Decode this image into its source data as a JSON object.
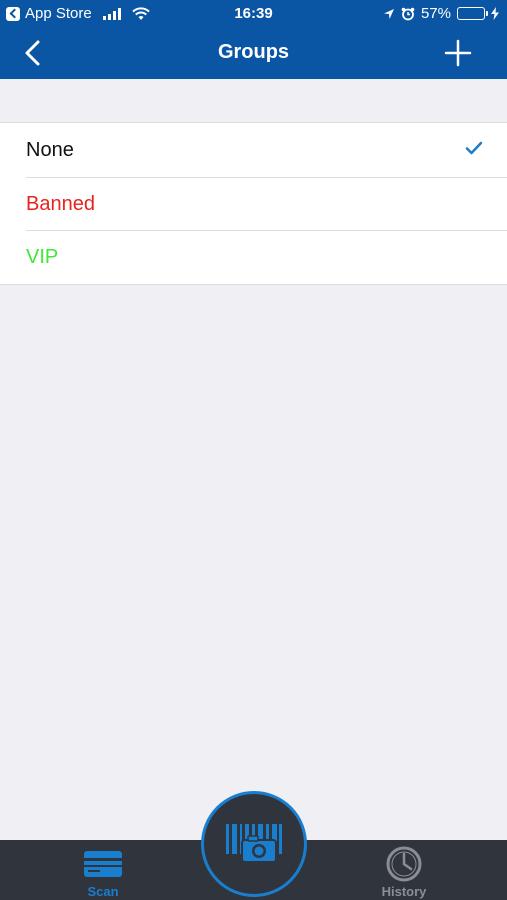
{
  "status_bar": {
    "back_app": "App Store",
    "time": "16:39",
    "battery": "57%",
    "battery_level": 0.57
  },
  "nav": {
    "title": "Groups"
  },
  "groups": [
    {
      "label": "None",
      "color": "#111111",
      "selected": true
    },
    {
      "label": "Banned",
      "color": "#e8231f",
      "selected": false
    },
    {
      "label": "VIP",
      "color": "#3ee83a",
      "selected": false
    }
  ],
  "tabbar": {
    "scan_label": "Scan",
    "history_label": "History",
    "active_color": "#1a7ecf",
    "inactive_color": "#8a8e94"
  },
  "icons": {
    "back": "chevron-left-icon",
    "add": "plus-icon",
    "check": "checkmark-icon",
    "scan_tab": "card-icon",
    "scan_button": "barcode-camera-icon",
    "history_tab": "clock-icon"
  }
}
